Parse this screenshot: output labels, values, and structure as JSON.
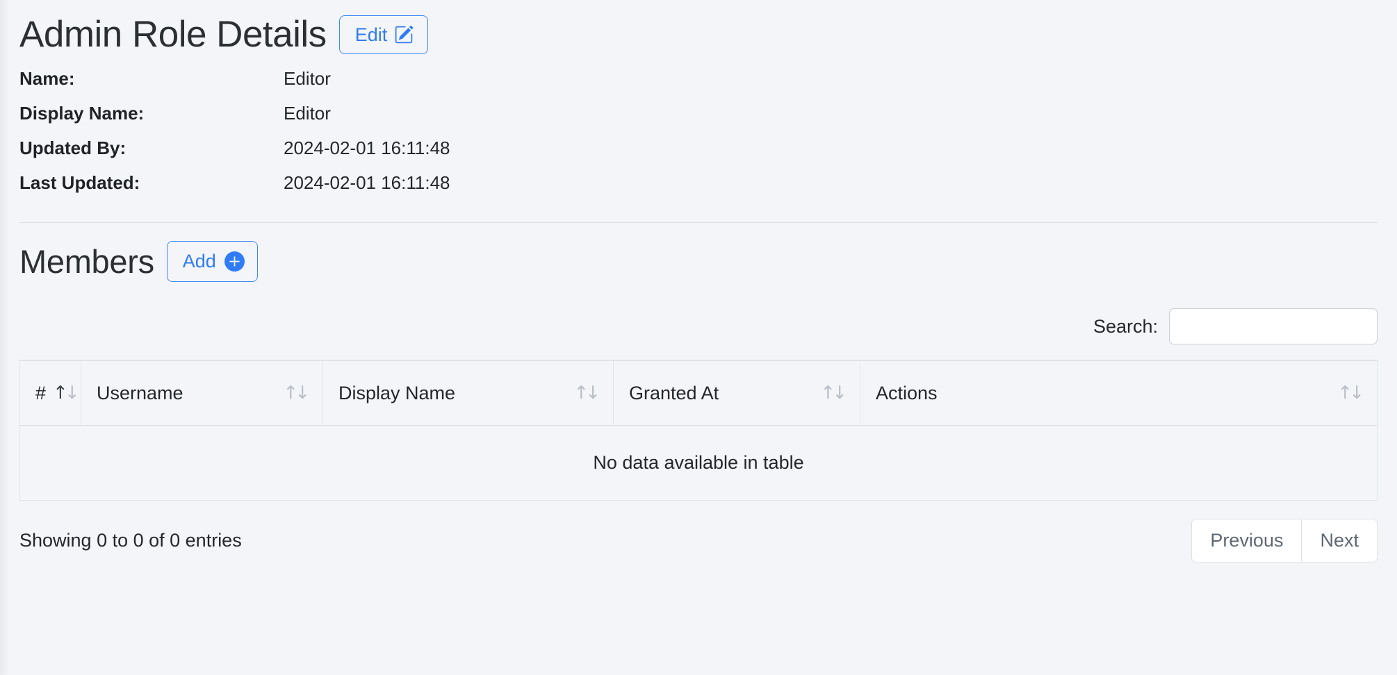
{
  "header": {
    "title": "Admin Role Details",
    "edit_button": {
      "label": "Edit",
      "icon": "edit-pencil-square-icon"
    }
  },
  "details": {
    "rows": [
      {
        "label": "Name:",
        "value": "Editor"
      },
      {
        "label": "Display Name:",
        "value": "Editor"
      },
      {
        "label": "Updated By:",
        "value": "2024-02-01 16:11:48"
      },
      {
        "label": "Last Updated:",
        "value": "2024-02-01 16:11:48"
      }
    ]
  },
  "members": {
    "title": "Members",
    "add_button": {
      "label": "Add",
      "icon": "plus-circle-icon"
    },
    "search": {
      "label": "Search:",
      "value": "",
      "placeholder": ""
    },
    "table": {
      "columns": [
        {
          "label": "#",
          "sort": "asc"
        },
        {
          "label": "Username",
          "sort": "none"
        },
        {
          "label": "Display Name",
          "sort": "none"
        },
        {
          "label": "Granted At",
          "sort": "none"
        },
        {
          "label": "Actions",
          "sort": "none"
        }
      ],
      "rows": [],
      "empty_message": "No data available in table"
    },
    "footer": {
      "info": "Showing 0 to 0 of 0 entries",
      "previous_label": "Previous",
      "next_label": "Next"
    }
  },
  "colors": {
    "accent": "#2f7cf6",
    "page_background": "#f4f5f8",
    "text": "#23272b"
  }
}
